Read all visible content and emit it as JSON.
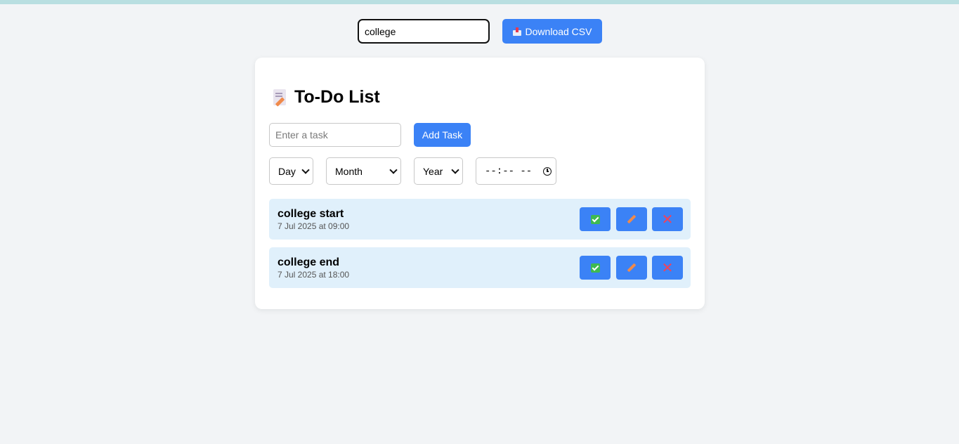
{
  "search": {
    "value": "college"
  },
  "toolbar": {
    "download_label": "Download CSV",
    "download_icon": "outbox-tray-icon"
  },
  "app": {
    "title": "To-Do List",
    "title_icon": "memo-icon",
    "task_input_placeholder": "Enter a task",
    "add_label": "Add Task",
    "day_select": "Day",
    "month_select": "Month",
    "year_select": "Year",
    "time_value": "--:-- --",
    "tasks": [
      {
        "name": "college start",
        "date": "7 Jul 2025 at 09:00"
      },
      {
        "name": "college end",
        "date": "7 Jul 2025 at 18:00"
      }
    ]
  },
  "colors": {
    "accent": "#3b82f6",
    "task_bg": "#e0f0fb",
    "page_bg": "#f2f4f6"
  }
}
